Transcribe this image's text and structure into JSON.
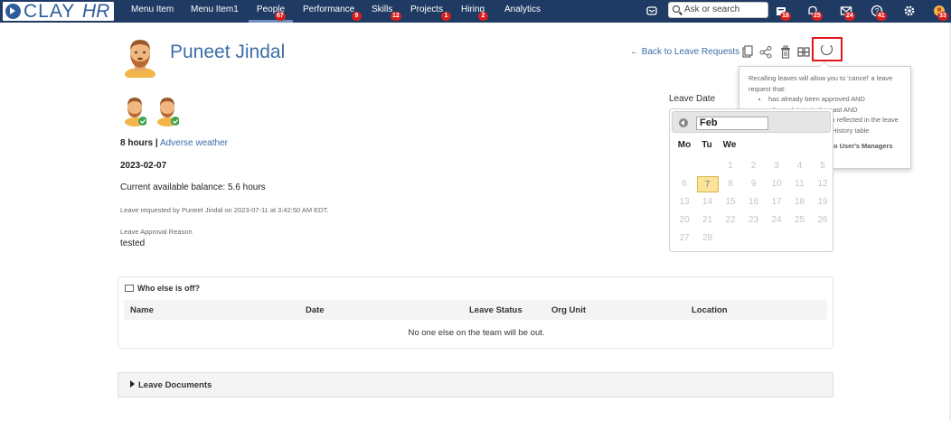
{
  "brand": {
    "name": "CLAY",
    "suffix": "HR"
  },
  "nav": [
    {
      "label": "Menu Item",
      "badge": ""
    },
    {
      "label": "Menu Item1",
      "badge": ""
    },
    {
      "label": "People",
      "badge": "67"
    },
    {
      "label": "Performance",
      "badge": "9"
    },
    {
      "label": "Skills",
      "badge": "12"
    },
    {
      "label": "Projects",
      "badge": "1"
    },
    {
      "label": "Hiring",
      "badge": "2"
    },
    {
      "label": "Analytics",
      "badge": ""
    }
  ],
  "search": {
    "placeholder": "Ask or search"
  },
  "top_icons": [
    {
      "name": "inbox-icon",
      "badge": ""
    },
    {
      "name": "tray-icon",
      "badge": "18"
    },
    {
      "name": "bell-icon",
      "badge": "25"
    },
    {
      "name": "mail-icon",
      "badge": "24"
    },
    {
      "name": "help-icon",
      "badge": "41"
    },
    {
      "name": "gear-icon",
      "badge": ""
    },
    {
      "name": "user-avatar-icon",
      "badge": "33"
    }
  ],
  "profile": {
    "name": "Puneet Jindal"
  },
  "actions": {
    "back": "← Back to Leave Requests"
  },
  "tooltip": {
    "intro": "Recalling leaves will allow you to 'cancel' a leave request that:",
    "items": [
      "has already been approved AND",
      "whose date is in the past AND",
      "That has already been reflected in the leave balance in the Leave History table"
    ],
    "note": "Recalls are only available to User's Managers and Site Admins."
  },
  "leave": {
    "hours": "8 hours |",
    "type": "Adverse weather",
    "date": "2023-02-07",
    "balance": "Current available balance: 5.6 hours",
    "requested": "Leave requested by Puneet Jindal on 2023-07-11 at 3:42:50 AM EDT.",
    "reason_label": "Leave Approval Reason",
    "reason": "tested"
  },
  "calendar": {
    "label": "Leave Date",
    "month": "Feb",
    "weekdays": [
      "Mo",
      "Tu",
      "We"
    ],
    "rows": [
      [
        "",
        "",
        "1",
        "2",
        "3",
        "4",
        "5"
      ],
      [
        "6",
        "7",
        "8",
        "9",
        "10",
        "11",
        "12"
      ],
      [
        "13",
        "14",
        "15",
        "16",
        "17",
        "18",
        "19"
      ],
      [
        "20",
        "21",
        "22",
        "23",
        "24",
        "25",
        "26"
      ],
      [
        "27",
        "28",
        "",
        "",
        "",
        "",
        ""
      ]
    ],
    "selected": "7"
  },
  "who_off": {
    "title": "Who else is off?",
    "columns": [
      "Name",
      "Date",
      "Leave Status",
      "Org Unit",
      "Location"
    ],
    "empty": "No one else on the team will be out."
  },
  "documents": {
    "title": "Leave Documents"
  }
}
